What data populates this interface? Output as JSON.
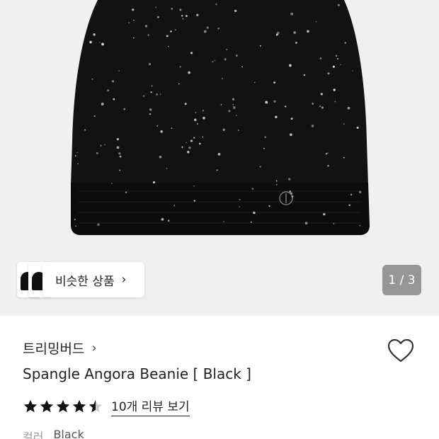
{
  "gallery": {
    "similar_label": "비슷한 상품",
    "pager_text": "1 / 3"
  },
  "product": {
    "brand": "트리밍버드",
    "title": "Spangle Angora Beanie [ Black ]",
    "rating": 4.5,
    "review_link": "10개 리뷰 보기",
    "color_label": "컬러",
    "color_value": "Black"
  },
  "icons": {
    "brand_chevron": "chevron-right-icon",
    "wishlist": "heart-icon",
    "similar_chevron": "chevron-right-icon"
  },
  "colors": {
    "hero_background": "#f0f0f0",
    "beanie": "#111111",
    "text": "#222222"
  }
}
